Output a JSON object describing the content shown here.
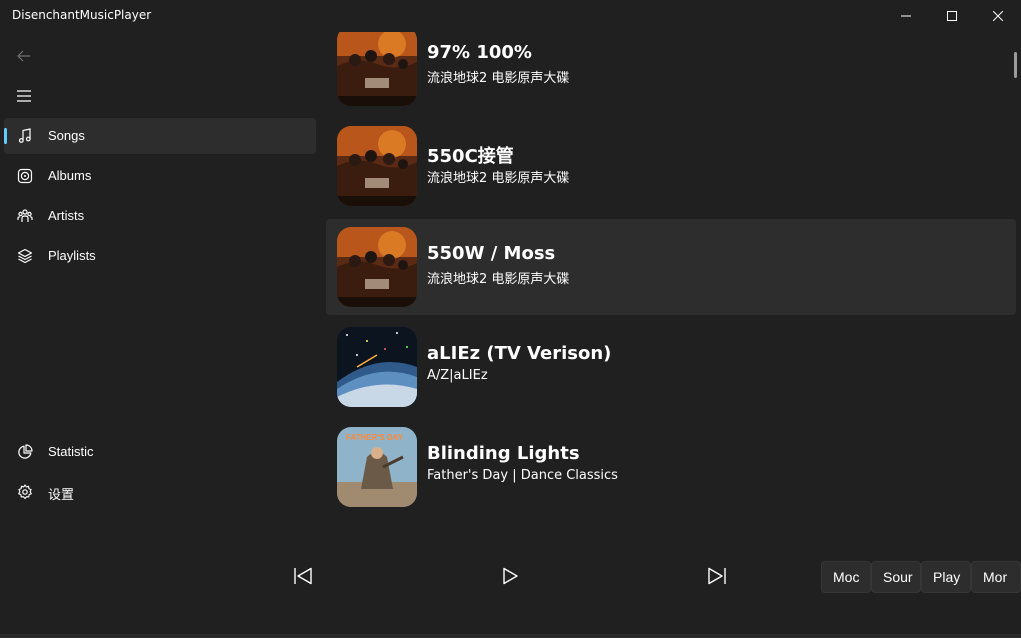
{
  "window": {
    "title": "DisenchantMusicPlayer",
    "minimize_icon": "minimize-icon",
    "maximize_icon": "maximize-icon",
    "close_icon": "close-icon"
  },
  "nav": {
    "back_icon": "back-arrow-icon",
    "menu_icon": "hamburger-menu-icon",
    "items": [
      {
        "label": "Songs",
        "icon": "music-note-icon",
        "selected": true
      },
      {
        "label": "Albums",
        "icon": "album-disc-icon",
        "selected": false
      },
      {
        "label": "Artists",
        "icon": "people-icon",
        "selected": false
      },
      {
        "label": "Playlists",
        "icon": "layers-icon",
        "selected": false
      }
    ],
    "footer_items": [
      {
        "label": "Statistic",
        "icon": "pie-chart-icon"
      },
      {
        "label": "设置",
        "icon": "gear-icon"
      }
    ]
  },
  "songs": [
    {
      "title": "97% 100%",
      "subtitle": "流浪地球2 电影原声大碟",
      "cover": "wandering-earth-cover"
    },
    {
      "title": "550C接管",
      "subtitle": "流浪地球2 电影原声大碟",
      "cover": "wandering-earth-cover"
    },
    {
      "title": "550W / Moss",
      "subtitle": "流浪地球2 电影原声大碟",
      "cover": "wandering-earth-cover",
      "hovered": true
    },
    {
      "title": "aLIEz (TV Verison)",
      "subtitle": "A/Z|aLIEz",
      "cover": "aliez-earth-cover"
    },
    {
      "title": "Blinding Lights",
      "subtitle": "Father's Day | Dance Classics",
      "cover": "fathers-day-cover",
      "cover_text": "FATHER'S DAY"
    }
  ],
  "player": {
    "previous_icon": "skip-previous-icon",
    "play_icon": "play-icon",
    "next_icon": "skip-next-icon",
    "side_buttons": [
      "Moc",
      "Sour",
      "Play",
      "Mor"
    ]
  },
  "colors": {
    "background": "#202020",
    "selected": "#2d2d2d",
    "accent": "#60cdff"
  }
}
